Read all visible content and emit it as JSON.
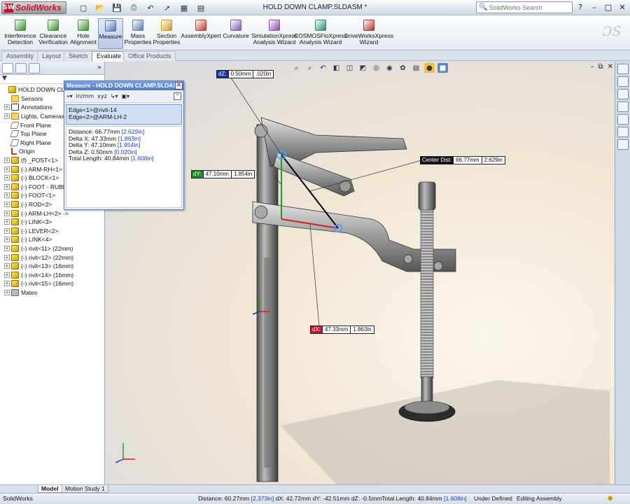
{
  "app": {
    "logo": "SolidWorks",
    "document_title": "HOLD DOWN CLAMP.SLDASM *",
    "search_placeholder": "SolidWorks Search",
    "window_controls": [
      "?",
      "–",
      "□",
      "✕"
    ]
  },
  "quick_access": [
    {
      "name": "new",
      "glyph": "▢"
    },
    {
      "name": "open",
      "glyph": "📂"
    },
    {
      "name": "save",
      "glyph": "💾"
    },
    {
      "name": "print",
      "glyph": "⎙"
    },
    {
      "name": "undo",
      "glyph": "↶"
    },
    {
      "name": "select",
      "glyph": "➚"
    },
    {
      "name": "rebuild",
      "glyph": "▦"
    },
    {
      "name": "options",
      "glyph": "▤"
    }
  ],
  "command_manager": [
    {
      "name": "interference-detection",
      "label1": "Interference",
      "label2": "Detection",
      "color": "#3c8c2f"
    },
    {
      "name": "clearance-verification",
      "label1": "Clearance",
      "label2": "Verification",
      "color": "#3c8c2f"
    },
    {
      "name": "hole-alignment",
      "label1": "Hole",
      "label2": "Alignment",
      "color": "#3c8c2f"
    },
    {
      "name": "measure",
      "label1": "Measure",
      "label2": "",
      "color": "#4a74b8",
      "active": true
    },
    {
      "name": "mass-properties",
      "label1": "Mass",
      "label2": "Properties",
      "color": "#5a7bb0"
    },
    {
      "name": "section-properties",
      "label1": "Section",
      "label2": "Properties",
      "color": "#c49b1a"
    },
    {
      "name": "assemblyxpert",
      "label1": "AssemblyXpert",
      "label2": "",
      "color": "#c33a2a"
    },
    {
      "name": "curvature",
      "label1": "Curvature",
      "label2": "",
      "color": "#7b5ab0"
    },
    {
      "name": "simulationxpress",
      "label1": "SimulationXpress",
      "label2": "Analysis Wizard",
      "color": "#8a4aa8"
    },
    {
      "name": "cosmosfloxpress",
      "label1": "COSMOSFloXpress",
      "label2": "Analysis Wizard",
      "color": "#2f8a6a"
    },
    {
      "name": "driveworksxpress",
      "label1": "DriveWorksXpress",
      "label2": "Wizard",
      "color": "#b2302a"
    }
  ],
  "tabs": [
    "Assembly",
    "Layout",
    "Sketch",
    "Evaluate",
    "Office Products"
  ],
  "active_tab": "Evaluate",
  "feature_tree": [
    {
      "label": "HOLD DOWN CLAMP",
      "icon": "asm",
      "exp": "",
      "indent": 0
    },
    {
      "label": "Sensors",
      "icon": "folder",
      "exp": "",
      "indent": 1
    },
    {
      "label": "Annotations",
      "icon": "ann",
      "exp": "+",
      "indent": 1
    },
    {
      "label": "Lights, Cameras a",
      "icon": "folder",
      "exp": "+",
      "indent": 1
    },
    {
      "label": "Front Plane",
      "icon": "plane",
      "exp": "",
      "indent": 1
    },
    {
      "label": "Top Plane",
      "icon": "plane",
      "exp": "",
      "indent": 1
    },
    {
      "label": "Right Plane",
      "icon": "plane",
      "exp": "",
      "indent": 1
    },
    {
      "label": "Origin",
      "icon": "origin",
      "exp": "",
      "indent": 1
    },
    {
      "label": "(f) _POST<1>",
      "icon": "part",
      "exp": "+",
      "indent": 1
    },
    {
      "label": "(-) ARM-RH<1>",
      "icon": "part",
      "exp": "+",
      "indent": 1
    },
    {
      "label": "(-) BLOCK<1>",
      "icon": "part",
      "exp": "+",
      "indent": 1
    },
    {
      "label": "(-) FOOT - RUBBE",
      "icon": "part",
      "exp": "+",
      "indent": 1
    },
    {
      "label": "(-) FOOT<1>",
      "icon": "part",
      "exp": "+",
      "indent": 1
    },
    {
      "label": "(-) ROD<2>",
      "icon": "part",
      "exp": "+",
      "indent": 1
    },
    {
      "label": "(-) ARM-LH<2> ->",
      "icon": "part",
      "exp": "+",
      "indent": 1
    },
    {
      "label": "(-) LINK<3>",
      "icon": "part",
      "exp": "+",
      "indent": 1
    },
    {
      "label": "(-) LEVER<2>",
      "icon": "part",
      "exp": "+",
      "indent": 1
    },
    {
      "label": "(-) LINK<4>",
      "icon": "part",
      "exp": "+",
      "indent": 1
    },
    {
      "label": "(-) rivit<11> (22mm)",
      "icon": "part",
      "exp": "+",
      "indent": 1
    },
    {
      "label": "(-) rivit<12> (22mm)",
      "icon": "part",
      "exp": "+",
      "indent": 1
    },
    {
      "label": "(-) rivit<13> (16mm)",
      "icon": "part",
      "exp": "+",
      "indent": 1
    },
    {
      "label": "(-) rivit<14> (16mm)",
      "icon": "part",
      "exp": "+",
      "indent": 1
    },
    {
      "label": "(-) rivit<15> (16mm)",
      "icon": "part",
      "exp": "+",
      "indent": 1
    },
    {
      "label": "Mates",
      "icon": "mates",
      "exp": "+",
      "indent": 1
    }
  ],
  "fm_filter": "▼",
  "measure_dialog": {
    "title": "Measure - HOLD DOWN CLAMP.SLDASM",
    "selection": [
      "Edge<1>@rivit-14",
      "Edge<2>@ARM-LH-2"
    ],
    "results": [
      {
        "label": "Distance: 66.77mm ",
        "alt": "[2.629in]"
      },
      {
        "label": "Delta X: 47.33mm ",
        "alt": "[1.863in]"
      },
      {
        "label": "Delta Y: 47.10mm ",
        "alt": "[1.854in]"
      },
      {
        "label": "Delta Z: 0.50mm ",
        "alt": "[0.020in]"
      },
      {
        "label": "Total Length: 40.84mm ",
        "alt": "[1.608in]"
      }
    ]
  },
  "dimensions": {
    "dz": {
      "label": "dZ:",
      "v1": "0.50mm",
      "v2": ".020in",
      "color": "#1b2f9a"
    },
    "center": {
      "label": "Center Dist:",
      "v1": "66.77mm",
      "v2": "2.629in",
      "color": "#111111"
    },
    "dy": {
      "label": "dY:",
      "v1": "47.10mm",
      "v2": "1.854in",
      "color": "#1e8a1e"
    },
    "dx": {
      "label": "dX:",
      "v1": "47.33mm",
      "v2": "1.863in",
      "color": "#c8102e"
    }
  },
  "bottom_tabs": [
    "Model",
    "Motion Study 1"
  ],
  "status": {
    "app": "SolidWorks",
    "distance_label": "Distance: 60.27mm ",
    "distance_alt": "[2.373in]",
    "dx": "dX: 42.72mm",
    "dy": "dY: -42.51mm",
    "dz": "dZ: -0.5mm",
    "total_label": "Total Length: 40.84mm ",
    "total_alt": "[1.608in]",
    "under_defined": "Under Defined",
    "editing": "Editing Assembly"
  }
}
